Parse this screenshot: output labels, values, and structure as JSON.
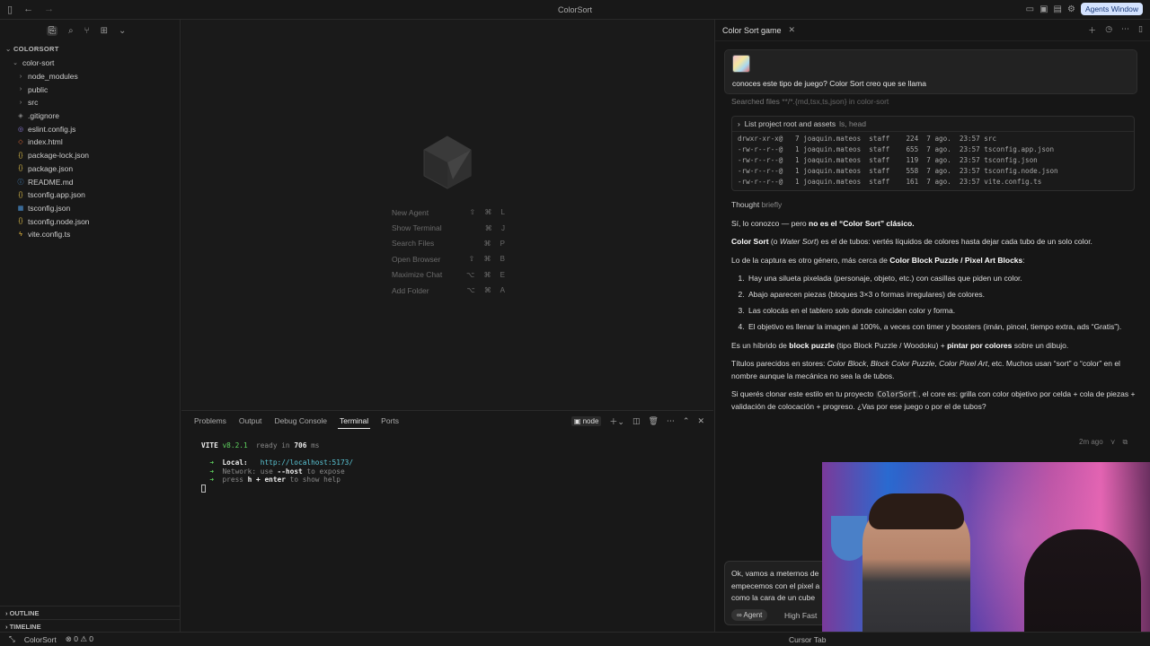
{
  "window": {
    "title": "ColorSort",
    "agents_button": "Agents Window"
  },
  "sidebar": {
    "root": "COLORSORT",
    "items": [
      {
        "label": "color-sort",
        "icon": "chevron-down-icon",
        "depth": 0
      },
      {
        "label": "node_modules",
        "icon": "chevron-right-icon",
        "depth": 1
      },
      {
        "label": "public",
        "icon": "chevron-right-icon",
        "depth": 1
      },
      {
        "label": "src",
        "icon": "chevron-right-icon",
        "depth": 1
      },
      {
        "label": ".gitignore",
        "icon": "git-icon",
        "depth": 1
      },
      {
        "label": "eslint.config.js",
        "icon": "eslint-icon",
        "depth": 1
      },
      {
        "label": "index.html",
        "icon": "html-icon",
        "depth": 1
      },
      {
        "label": "package-lock.json",
        "icon": "json-icon",
        "depth": 1
      },
      {
        "label": "package.json",
        "icon": "json-icon",
        "depth": 1
      },
      {
        "label": "README.md",
        "icon": "markdown-icon",
        "depth": 1
      },
      {
        "label": "tsconfig.app.json",
        "icon": "json-icon",
        "depth": 1
      },
      {
        "label": "tsconfig.json",
        "icon": "ts-icon",
        "depth": 1
      },
      {
        "label": "tsconfig.node.json",
        "icon": "json-icon",
        "depth": 1
      },
      {
        "label": "vite.config.ts",
        "icon": "vite-icon",
        "depth": 1
      }
    ],
    "outline": "OUTLINE",
    "timeline": "TIMELINE"
  },
  "editor": {
    "shortcuts": [
      {
        "label": "New Agent",
        "keys": "⇧ ⌘ L"
      },
      {
        "label": "Show Terminal",
        "keys": "⌘ J"
      },
      {
        "label": "Search Files",
        "keys": "⌘ P"
      },
      {
        "label": "Open Browser",
        "keys": "⇧ ⌘ B"
      },
      {
        "label": "Maximize Chat",
        "keys": "⌥ ⌘ E"
      },
      {
        "label": "Add Folder",
        "keys": "⌥ ⌘ A"
      }
    ]
  },
  "panel": {
    "tabs": [
      "Problems",
      "Output",
      "Debug Console",
      "Terminal",
      "Ports"
    ],
    "active_tab": "Terminal",
    "shell": "node",
    "terminal": {
      "vite": "VITE",
      "version": "v8.2.1",
      "ready": "ready in",
      "ms": "706",
      "ms_unit": "ms",
      "local_label": "Local:",
      "local_url": "http://localhost:5173/",
      "network_label": "Network:",
      "network_text": "use",
      "network_flag": "--host",
      "network_tail": "to expose",
      "help_pre": "press",
      "help_key": "h + enter",
      "help_tail": "to show help"
    }
  },
  "chat": {
    "tab_title": "Color Sort game",
    "user_message": "conoces este tipo de juego? Color Sort creo que se llama",
    "searched": "Searched files",
    "searched_pattern": "**/*.{md,tsx,ts,json} in color-sort",
    "tool_title": "List project root and assets",
    "tool_cmd": "ls, head",
    "ls_lines": [
      "drwxr-xr-x@   7 joaquin.mateos  staff    224  7 ago.  23:57 src",
      "-rw-r--r--@   1 joaquin.mateos  staff    655  7 ago.  23:57 tsconfig.app.json",
      "-rw-r--r--@   1 joaquin.mateos  staff    119  7 ago.  23:57 tsconfig.json",
      "-rw-r--r--@   1 joaquin.mateos  staff    558  7 ago.  23:57 tsconfig.node.json",
      "-rw-r--r--@   1 joaquin.mateos  staff    161  7 ago.  23:57 vite.config.ts"
    ],
    "thought": "Thought",
    "thought_dur": "briefly",
    "p1_pre": "Sí, lo conozco — pero ",
    "p1_b": "no es el “Color Sort” clásico",
    "p1_post": ".",
    "p2_b": "Color Sort",
    "p2_a": " (o ",
    "p2_i": "Water Sort",
    "p2_c": ") es el de tubos: vertés líquidos de colores hasta dejar cada tubo de un solo color.",
    "p3_pre": "Lo de la captura es otro género, más cerca de ",
    "p3_b": "Color Block Puzzle / Pixel Art Blocks",
    "p3_post": ":",
    "list": [
      "Hay una silueta pixelada (personaje, objeto, etc.) con casillas que piden un color.",
      "Abajo aparecen piezas (bloques 3×3 o formas irregulares) de colores.",
      "Las colocás en el tablero solo donde coinciden color y forma.",
      "El objetivo es llenar la imagen al 100%, a veces con timer y boosters (imán, pincel, tiempo extra, ads “Gratis”)."
    ],
    "p4_pre": "Es un híbrido de ",
    "p4_b1": "block puzzle",
    "p4_mid": " (tipo Block Puzzle / Woodoku) + ",
    "p4_b2": "pintar por colores",
    "p4_post": " sobre un dibujo.",
    "p5_pre": "Títulos parecidos en stores: ",
    "p5_i1": "Color Block",
    "p5_c1": ", ",
    "p5_i2": "Block Color Puzzle",
    "p5_c2": ", ",
    "p5_i3": "Color Pixel Art",
    "p5_post": ", etc. Muchos usan “sort” o “color” en el nombre aunque la mecánica no sea la de tubos.",
    "p6_pre": "Si querés clonar este estilo en tu proyecto ",
    "p6_code": "ColorSort",
    "p6_post": ", el core es: grilla con color objetivo por celda + cola de piezas + validación de colocación + progreso. ¿Vas por ese juego o por el de tubos?",
    "time": "2m ago",
    "composer_lines": [
      "Ok, vamos a meternos de",
      "empecemos con el pixel a",
      "como la cara de un cube"
    ],
    "agent_mode": "∞ Agent",
    "model": "High Fast"
  },
  "statusbar": {
    "project": "ColorSort",
    "errors": "0",
    "warnings": "0",
    "right": "Cursor Tab"
  }
}
